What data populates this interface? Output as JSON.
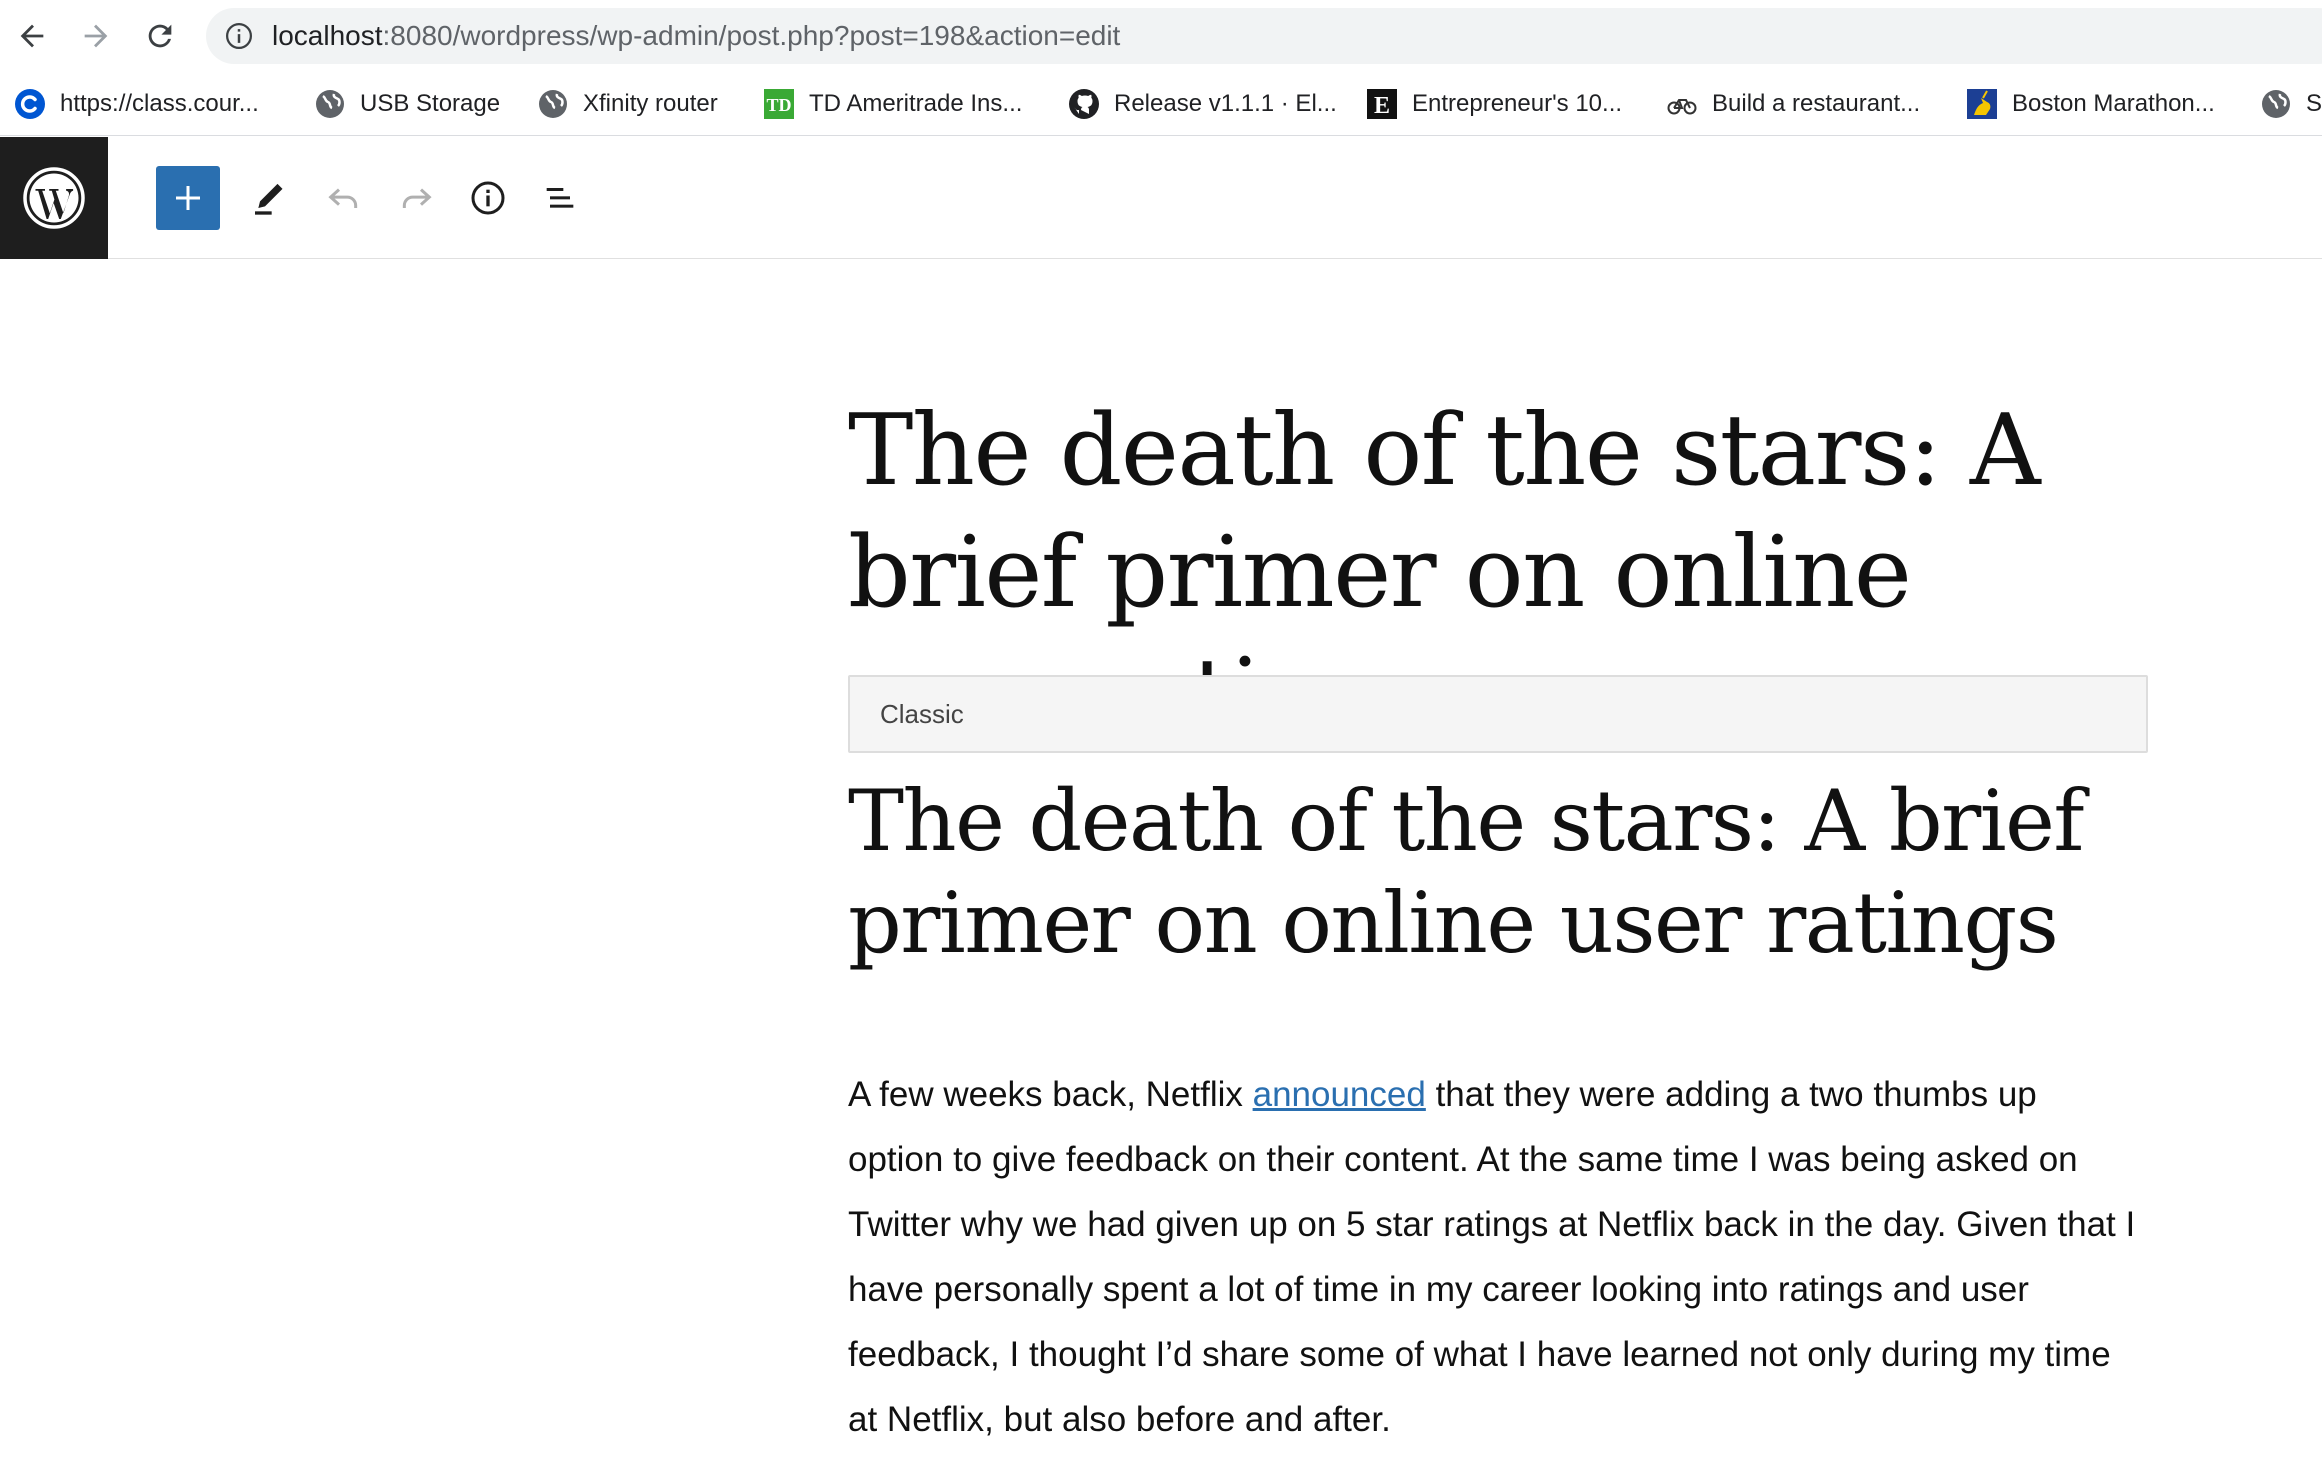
{
  "browser": {
    "url_host": "localhost",
    "url_rest": ":8080/wordpress/wp-admin/post.php?post=198&action=edit",
    "bookmarks": [
      {
        "label": "https://class.cour...",
        "icon": "coursera-icon"
      },
      {
        "label": "USB Storage",
        "icon": "globe-icon"
      },
      {
        "label": "Xfinity router",
        "icon": "globe-icon"
      },
      {
        "label": "TD Ameritrade Ins...",
        "icon": "td-icon"
      },
      {
        "label": "Release v1.1.1 · El...",
        "icon": "github-icon"
      },
      {
        "label": "Entrepreneur's 10...",
        "icon": "entrepreneur-icon"
      },
      {
        "label": "Build a restaurant...",
        "icon": "bike-icon"
      },
      {
        "label": "Boston Marathon...",
        "icon": "unicorn-icon"
      },
      {
        "label": "S",
        "icon": "globe-icon"
      }
    ]
  },
  "editor": {
    "post_title": "The death of the stars: A brief primer on online user ratings",
    "classic_block_label": "Classic",
    "content_heading": "The death of the stars: A brief primer on online user ratings",
    "paragraph": {
      "before_link": "A few weeks back, Netflix ",
      "link_text": "announced",
      "after_link": " that they were adding a two thumbs up option to give feedback on their content. At the same time I was being asked on Twitter why we had given up on 5 star ratings at Netflix back in the day. Given that I have personally spent a lot of time in my career looking into ratings and user feedback, I thought I’d share some of what I have learned not only during my time at Netflix, but also before and after."
    }
  },
  "colors": {
    "wp_blue": "#2a6fb0",
    "wp_dark": "#1e1e1e",
    "url_bar_bg": "#f1f3f4"
  }
}
